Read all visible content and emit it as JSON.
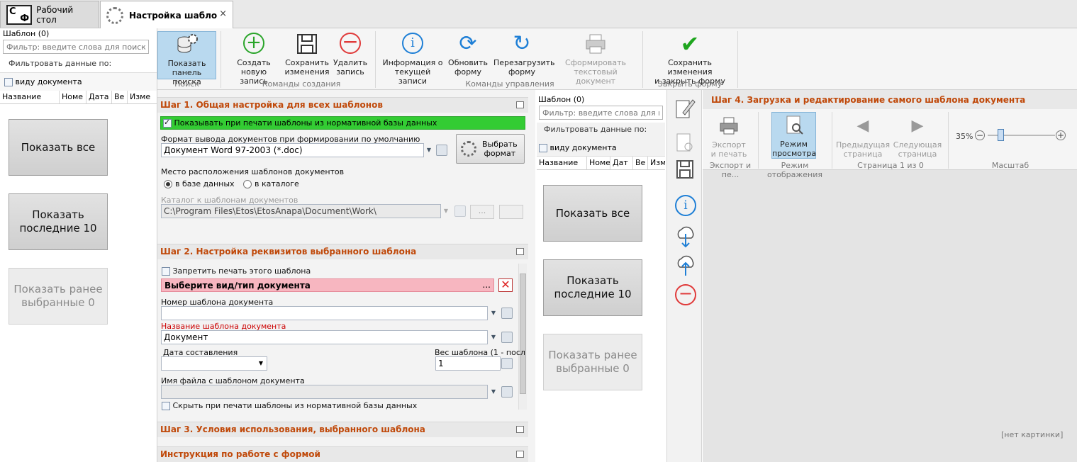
{
  "tabs": {
    "desktop": "Рабочий стол",
    "settings": "Настройка шабло",
    "close": "×",
    "logo_c": "С",
    "logo_f": "Ф"
  },
  "left": {
    "title": "Шаблон (0)",
    "filter_placeholder": "Фильтр: введите слова для поиска",
    "filter_by": "Фильтровать данные по:",
    "doc_type": "виду документа",
    "columns": [
      "Название",
      "Номе",
      "Дата",
      "Ве",
      "Изме"
    ],
    "btn_show_all": "Показать все",
    "btn_last10_line1": "Показать",
    "btn_last10_line2": "последние 10",
    "btn_prev_line1": "Показать ранее",
    "btn_prev_line2": "выбранные 0"
  },
  "ribbon": {
    "search_panel_1": "Показать",
    "search_panel_2": "панель поиска",
    "group_search": "Поиск",
    "create_1": "Создать",
    "create_2": "новую запись",
    "save_1": "Сохранить",
    "save_2": "изменения",
    "delete_1": "Удалить",
    "delete_2": "запись",
    "group_create": "Команды создания",
    "info_1": "Информация о",
    "info_2": "текущей записи",
    "refresh_1": "Обновить",
    "refresh_2": "форму",
    "reload_1": "Перезагрузить",
    "reload_2": "форму",
    "print_1": "Сформировать",
    "print_2": "текстовый документ",
    "group_manage": "Команды управления",
    "saveclose_1": "Сохранить изменения",
    "saveclose_2": "и закрыть форму",
    "group_close": "Закрыть форму"
  },
  "step1": {
    "title": "Шаг 1. Общая настройка для всех шаблонов",
    "show_normative": "Показывать при печати шаблоны из нормативной базы данных",
    "format_label": "Формат вывода документов при формировании по умолчанию",
    "format_value": "Документ Word 97-2003 (*.doc)",
    "choose_format_1": "Выбрать",
    "choose_format_2": "формат",
    "location_label": "Место расположения шаблонов документов",
    "in_db": "в базе данных",
    "in_catalog": "в каталоге",
    "catalog_label": "Каталог к шаблонам документов",
    "catalog_value": "C:\\Program Files\\Etos\\EtosAnapa\\Document\\Work\\",
    "dots": "..."
  },
  "step2": {
    "title": "Шаг 2. Настройка реквизитов выбранного шаблона",
    "forbid_print": "Запретить печать этого шаблона",
    "doc_type": "Выберите вид/тип документа",
    "doc_type_dots": "...",
    "number_label": "Номер шаблона документа",
    "number_value": "",
    "name_label": "Название шаблона документа",
    "name_value": "Документ",
    "date_label": "Дата составления",
    "weight_label": "Вес шаблона (1 - посл",
    "weight_value": "1",
    "filename_label": "Имя файла с шаблоном документа",
    "hide_normative": "Скрыть при печати шаблоны из нормативной базы данных"
  },
  "step3": {
    "title": "Шаг 3. Условия использования, выбранного шаблона"
  },
  "instr": {
    "title": "Инструкция по работе с формой"
  },
  "middle": {
    "title": "Шаблон (0)",
    "filter_placeholder": "Фильтр: введите слова для поиск",
    "filter_by": "Фильтровать данные по:",
    "doc_type": "виду документа",
    "columns": [
      "Название",
      "Номе",
      "Дат",
      "Ве",
      "Изм"
    ],
    "btn_show_all": "Показать все",
    "btn_last10_line1": "Показать",
    "btn_last10_line2": "последние 10",
    "btn_prev_line1": "Показать ранее",
    "btn_prev_line2": "выбранные 0"
  },
  "step4": {
    "title": "Шаг 4. Загрузка и редактирование самого шаблона документа",
    "export_1": "Экспорт",
    "export_2": "и печать",
    "group_export": "Экспорт и пе...",
    "view_1": "Режим",
    "view_2": "просмотра",
    "group_view": "Режим отображения",
    "prev_1": "Предыдущая",
    "prev_2": "страница",
    "next_1": "Следующая",
    "next_2": "страница",
    "group_page": "Страница 1 из 0",
    "zoom": "35%",
    "group_zoom": "Масштаб",
    "no_picture": "[нет картинки]"
  },
  "colors": {
    "section_title": "#c0490a",
    "green_row": "#33cc33",
    "pink_row": "#f7b6c0",
    "selected": "#b9d9ef"
  }
}
